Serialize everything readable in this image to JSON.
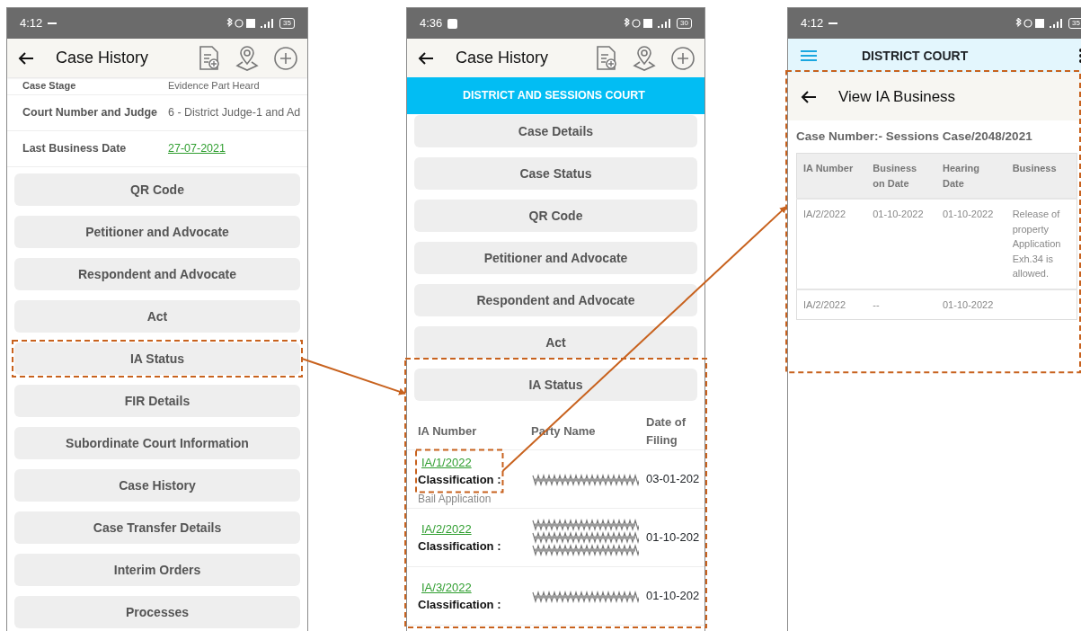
{
  "screens": [
    {
      "kind": "case_history",
      "status_bar": {
        "time": "4:12",
        "battery": "35"
      },
      "title": "Case History",
      "details": [
        {
          "label": "Case Stage",
          "value": "Evidence Part Heard",
          "link": false
        },
        {
          "label": "Court Number and Judge",
          "value": "6 - District Judge-1 and Ad",
          "link": false
        },
        {
          "label": "Last Business Date",
          "value": "27-07-2021",
          "link": true
        }
      ],
      "buttons": [
        {
          "label": "QR Code",
          "highlighted": false
        },
        {
          "label": "Petitioner and Advocate",
          "highlighted": false
        },
        {
          "label": "Respondent and Advocate",
          "highlighted": false
        },
        {
          "label": "Act",
          "highlighted": false
        },
        {
          "label": "IA Status",
          "highlighted": true
        },
        {
          "label": "FIR Details",
          "highlighted": false
        },
        {
          "label": "Subordinate Court Information",
          "highlighted": false
        },
        {
          "label": "Case History",
          "highlighted": false
        },
        {
          "label": "Case Transfer Details",
          "highlighted": false
        },
        {
          "label": "Interim Orders",
          "highlighted": false
        },
        {
          "label": "Processes",
          "highlighted": false
        }
      ]
    },
    {
      "kind": "case_history_ia",
      "status_bar": {
        "time": "4:36",
        "battery": "30"
      },
      "title": "Case History",
      "banner": "DISTRICT AND SESSIONS COURT",
      "buttons": [
        {
          "label": "Case Details",
          "highlighted": false
        },
        {
          "label": "Case Status",
          "highlighted": false
        },
        {
          "label": "QR Code",
          "highlighted": false
        },
        {
          "label": "Petitioner and Advocate",
          "highlighted": false
        },
        {
          "label": "Respondent and Advocate",
          "highlighted": false
        },
        {
          "label": "Act",
          "highlighted": false
        }
      ],
      "ia_section": {
        "highlighted": true,
        "button": "IA Status",
        "columns": [
          "IA Number",
          "Party Name",
          "Date of Filing"
        ],
        "rows": [
          {
            "ia_number": "IA/1/2022",
            "classification_label": "Classification :",
            "classification": "Bail Application",
            "kind": "short_party",
            "date": "03-01-202",
            "highlighted": true
          },
          {
            "ia_number": "IA/2/2022",
            "classification_label": "Classification :",
            "kind": "tall_party",
            "date": "01-10-202",
            "highlighted": false
          },
          {
            "ia_number": "IA/3/2022",
            "classification_label": "Classification :",
            "kind": "short_party",
            "date": "01-10-202",
            "highlighted": false
          }
        ]
      }
    },
    {
      "kind": "view_ia_business",
      "status_bar": {
        "time": "4:12",
        "battery": "35"
      },
      "app_title": "DISTRICT COURT",
      "content": {
        "highlighted": true,
        "title": "View IA Business",
        "case_number": "Case Number:- Sessions Case/2048/2021",
        "columns": [
          "IA Number",
          "Business on Date",
          "Hearing Date",
          "Business"
        ],
        "rows": [
          {
            "cells": [
              "IA/2/2022",
              "01-10-2022",
              "01-10-2022",
              "Release of property Application Exh.34  is allowed."
            ]
          },
          {
            "cells": [
              "IA/2/2022",
              "--",
              "01-10-2022"
            ]
          }
        ]
      }
    }
  ]
}
